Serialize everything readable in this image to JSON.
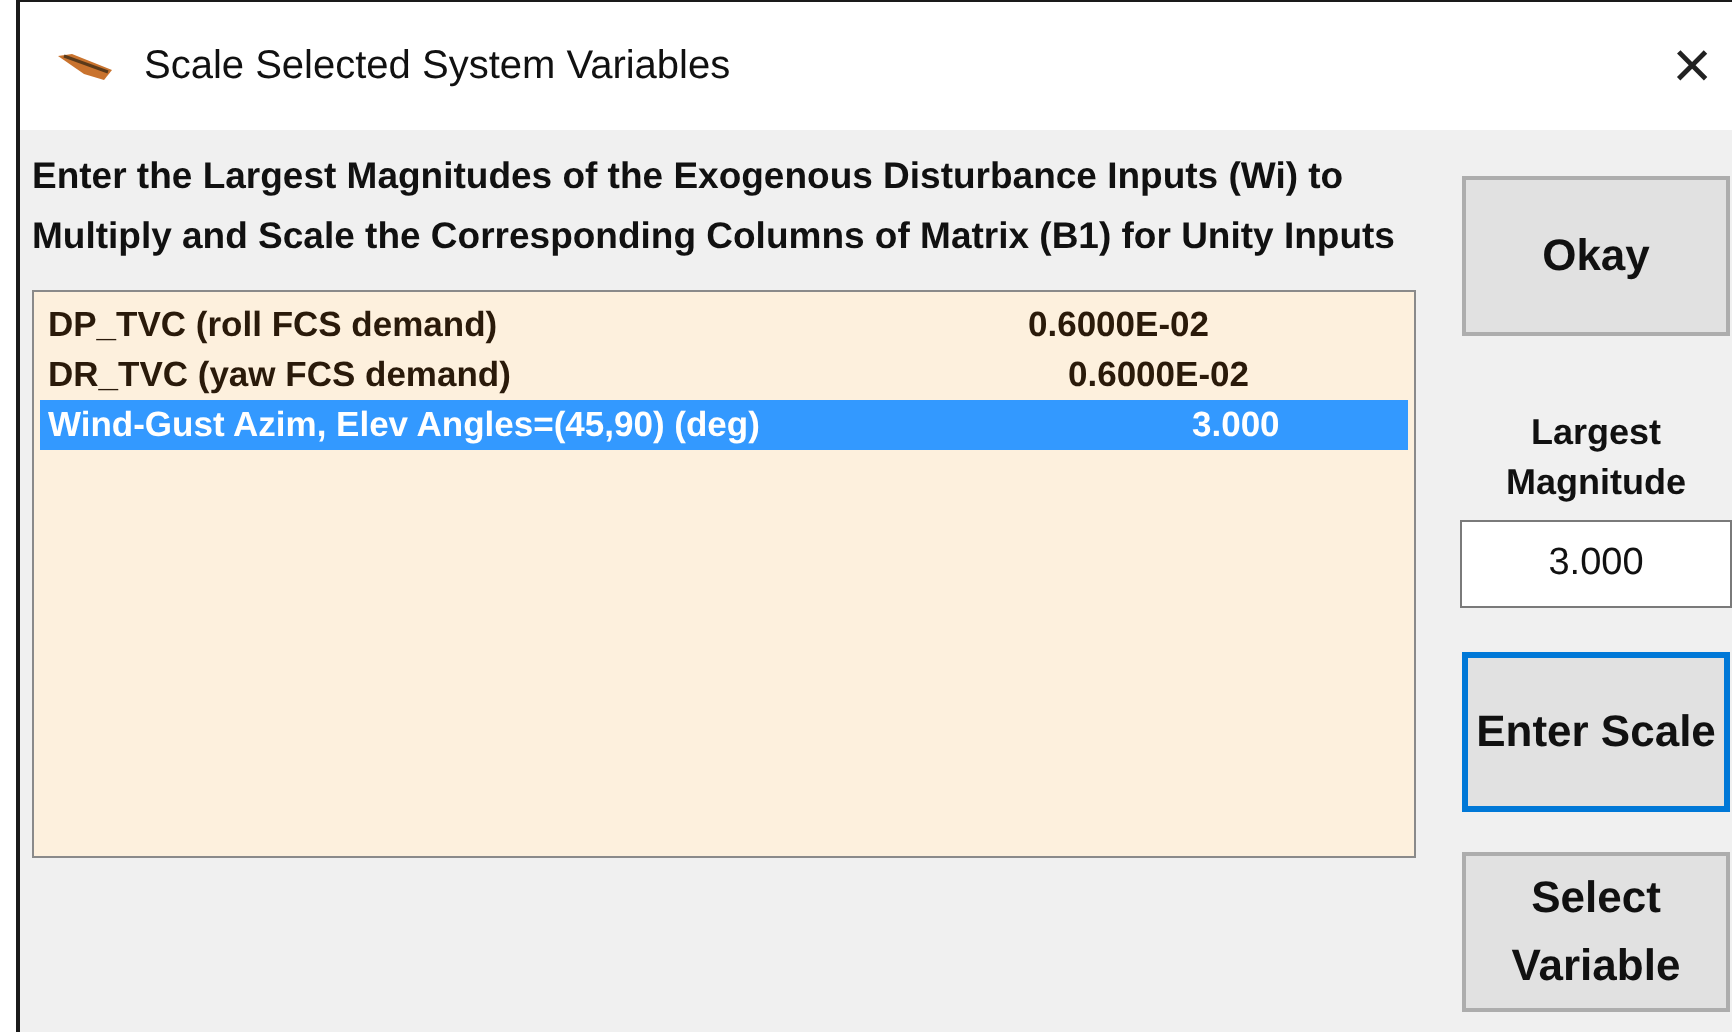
{
  "window": {
    "title": "Scale Selected System Variables",
    "close": "×"
  },
  "instructions": "Enter the Largest Magnitudes of the Exogenous Disturbance Inputs (Wi) to Multiply and Scale the Corresponding Columns of Matrix (B1) for Unity Inputs",
  "variables": [
    {
      "name": "DP_TVC (roll FCS demand)",
      "value": "0.6000E-02",
      "selected": false
    },
    {
      "name": "DR_TVC (yaw FCS demand)",
      "value": "0.6000E-02",
      "selected": false
    },
    {
      "name": "Wind-Gust Azim, Elev Angles=(45,90) (deg)",
      "value": "3.000",
      "selected": true
    }
  ],
  "magnitude": {
    "label": "Largest Magnitude",
    "value": "3.000"
  },
  "buttons": [
    {
      "kind": "okay",
      "label": "Okay",
      "focused": false
    },
    {
      "kind": "enter",
      "label": "Enter Scale",
      "focused": true
    },
    {
      "kind": "select",
      "label": "Select Variable",
      "focused": false
    }
  ]
}
